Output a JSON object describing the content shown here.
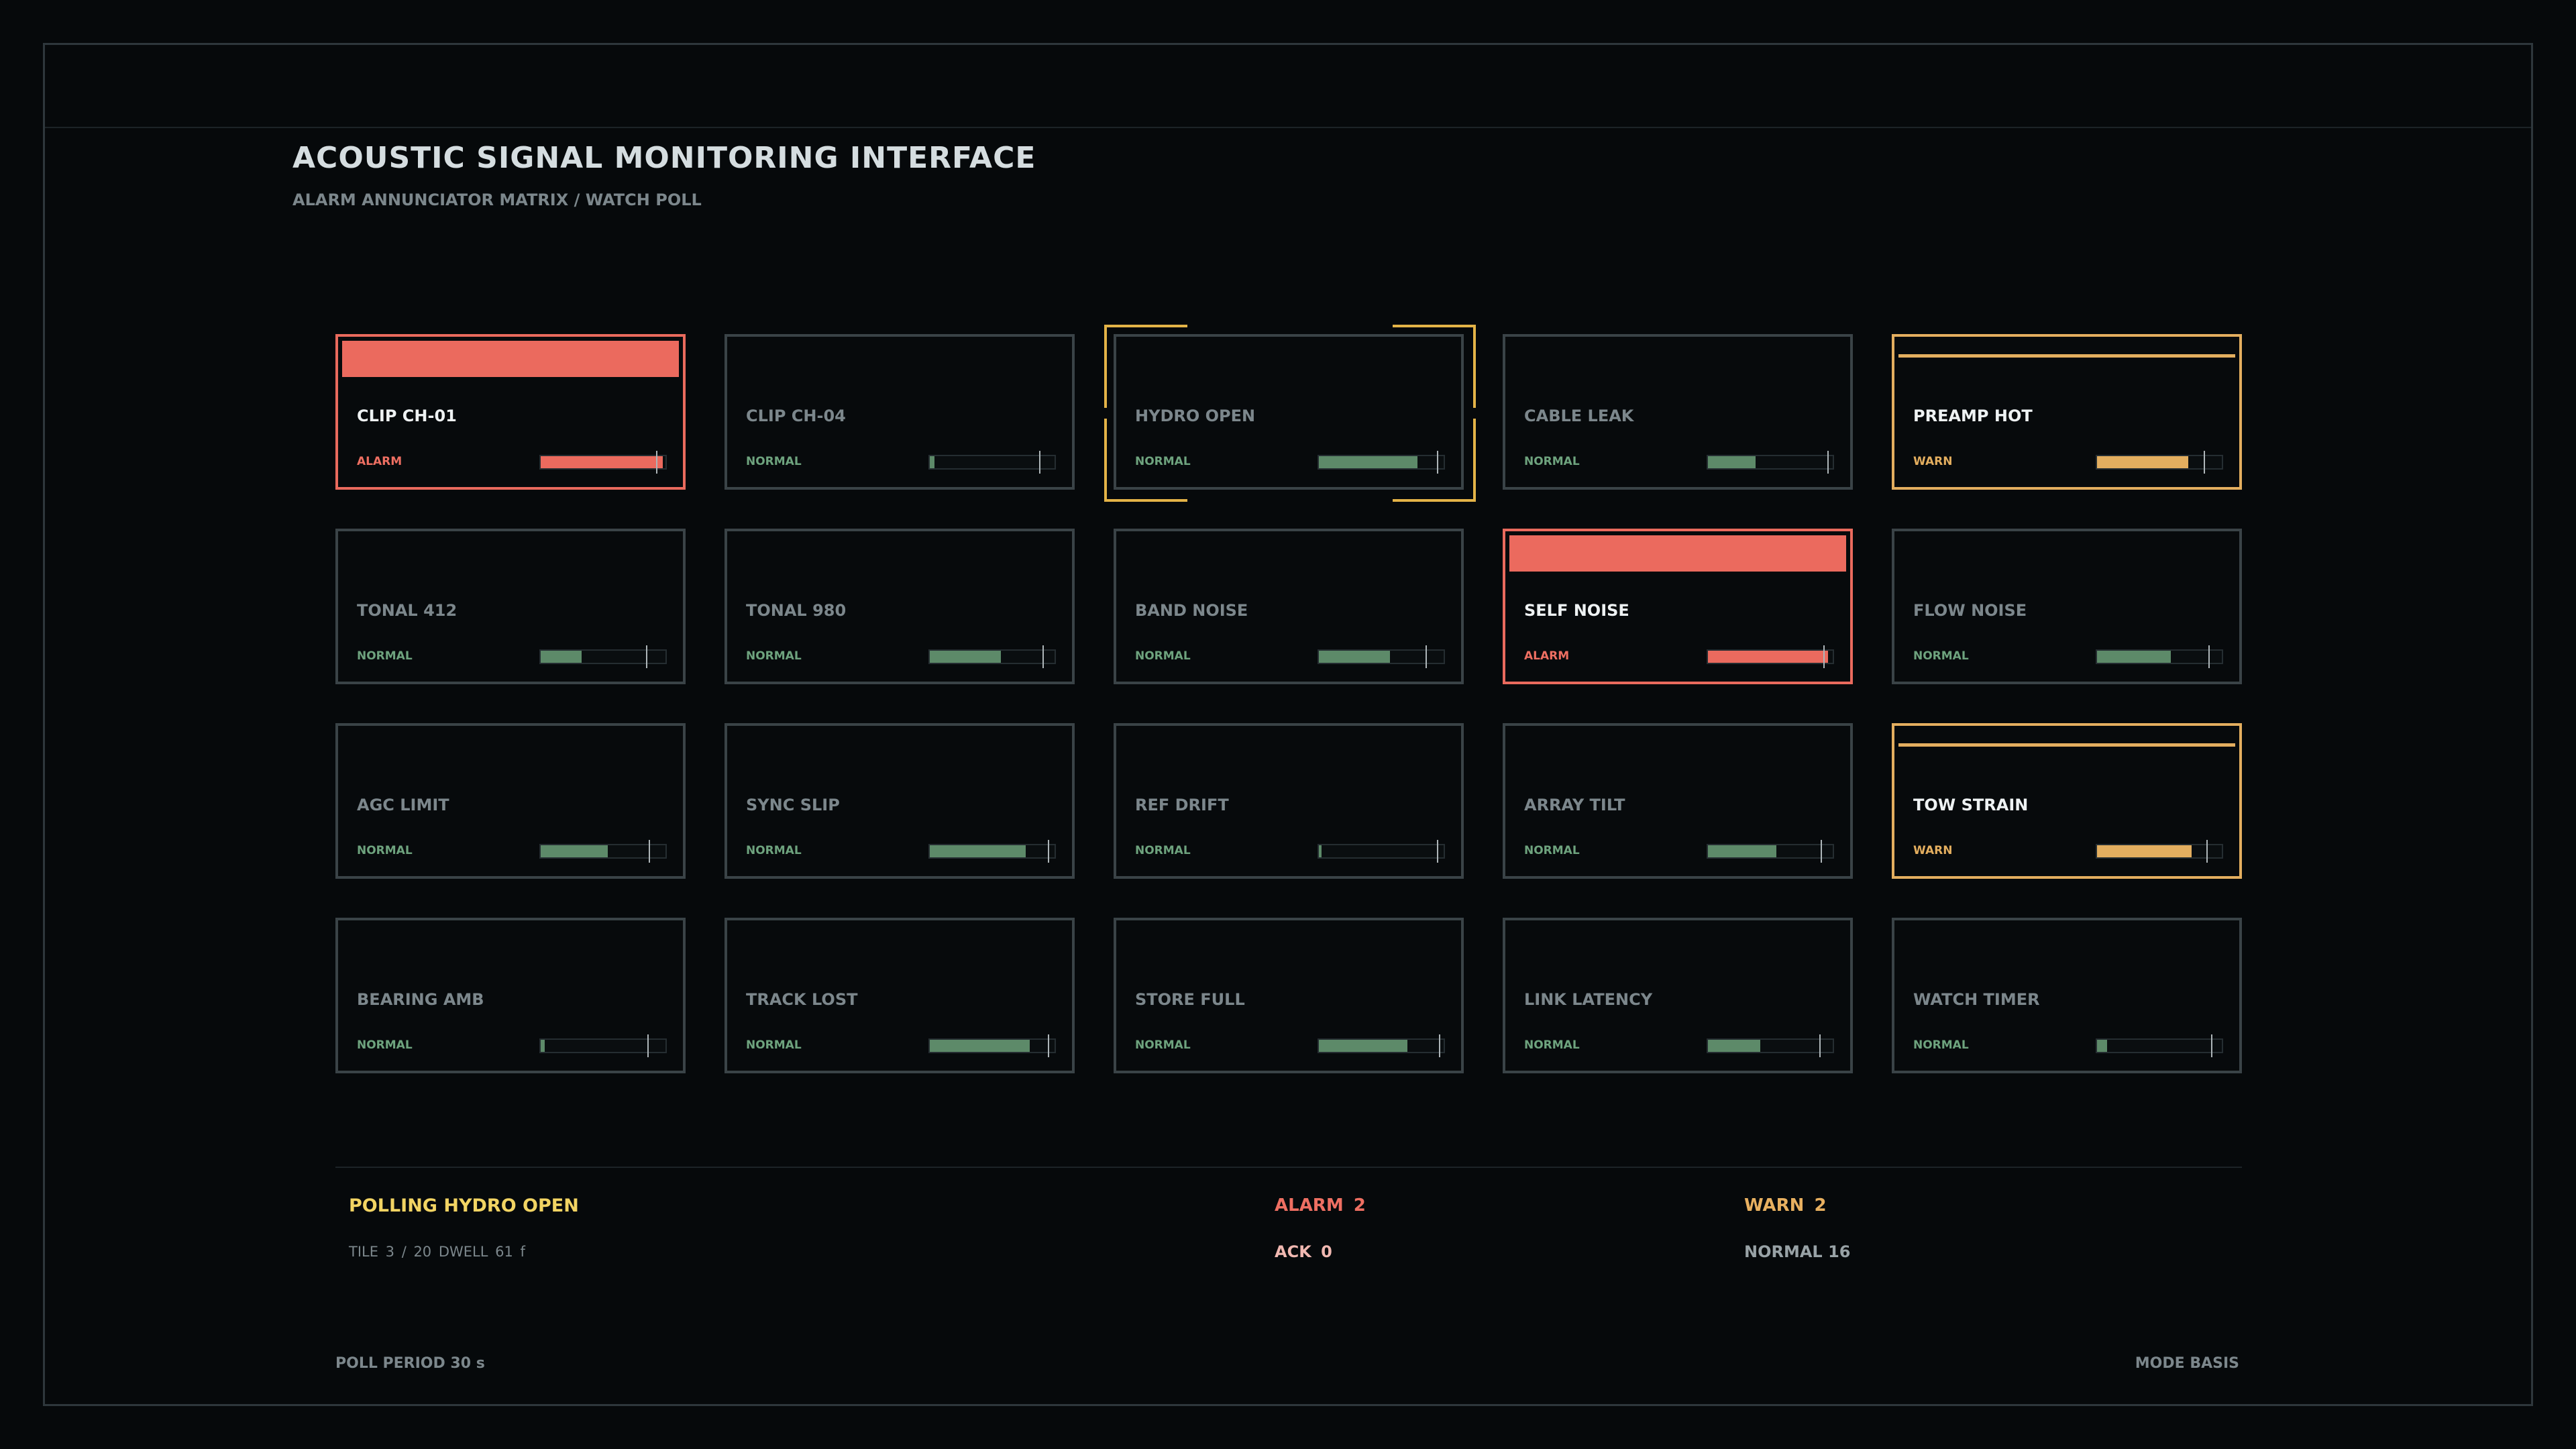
{
  "header": {
    "title": "ACOUSTIC SIGNAL MONITORING INTERFACE",
    "subtitle": "ALARM ANNUNCIATOR MATRIX / WATCH POLL"
  },
  "colors": {
    "alarm": "#eb6a5e",
    "warn": "#e3ae5f",
    "normal": "#5d8a69",
    "poll_cursor": "#e3b347",
    "background": "#06090b"
  },
  "tiles": [
    {
      "name": "CLIP CH-01",
      "state": "ALARM",
      "level": 0.98,
      "threshold": 0.93
    },
    {
      "name": "CLIP CH-04",
      "state": "NORMAL",
      "level": 0.04,
      "threshold": 0.88
    },
    {
      "name": "HYDRO OPEN",
      "state": "NORMAL",
      "level": 0.79,
      "threshold": 0.95,
      "polling": true
    },
    {
      "name": "CABLE LEAK",
      "state": "NORMAL",
      "level": 0.38,
      "threshold": 0.96
    },
    {
      "name": "PREAMP HOT",
      "state": "WARN",
      "level": 0.73,
      "threshold": 0.86
    },
    {
      "name": "TONAL 412",
      "state": "NORMAL",
      "level": 0.33,
      "threshold": 0.85
    },
    {
      "name": "TONAL 980",
      "state": "NORMAL",
      "level": 0.57,
      "threshold": 0.91
    },
    {
      "name": "BAND NOISE",
      "state": "NORMAL",
      "level": 0.57,
      "threshold": 0.86
    },
    {
      "name": "SELF NOISE",
      "state": "ALARM",
      "level": 0.96,
      "threshold": 0.93
    },
    {
      "name": "FLOW NOISE",
      "state": "NORMAL",
      "level": 0.59,
      "threshold": 0.9
    },
    {
      "name": "AGC LIMIT",
      "state": "NORMAL",
      "level": 0.54,
      "threshold": 0.87
    },
    {
      "name": "SYNC SLIP",
      "state": "NORMAL",
      "level": 0.77,
      "threshold": 0.95
    },
    {
      "name": "REF DRIFT",
      "state": "NORMAL",
      "level": 0.02,
      "threshold": 0.95
    },
    {
      "name": "ARRAY TILT",
      "state": "NORMAL",
      "level": 0.55,
      "threshold": 0.91
    },
    {
      "name": "TOW STRAIN",
      "state": "WARN",
      "level": 0.76,
      "threshold": 0.88
    },
    {
      "name": "BEARING AMB",
      "state": "NORMAL",
      "level": 0.03,
      "threshold": 0.86
    },
    {
      "name": "TRACK LOST",
      "state": "NORMAL",
      "level": 0.8,
      "threshold": 0.95
    },
    {
      "name": "STORE FULL",
      "state": "NORMAL",
      "level": 0.71,
      "threshold": 0.97
    },
    {
      "name": "LINK LATENCY",
      "state": "NORMAL",
      "level": 0.42,
      "threshold": 0.9
    },
    {
      "name": "WATCH TIMER",
      "state": "NORMAL",
      "level": 0.08,
      "threshold": 0.92
    }
  ],
  "status": {
    "polling": "POLLING HYDRO OPEN",
    "tile_info": "TILE 3 / 20  DWELL 61 f",
    "alarm": "ALARM 2",
    "ack": "ACK 0",
    "warn": "WARN 2",
    "normal": "NORMAL 16"
  },
  "footer": {
    "poll_period": "POLL PERIOD 30 s",
    "mode": "MODE BASIS"
  }
}
